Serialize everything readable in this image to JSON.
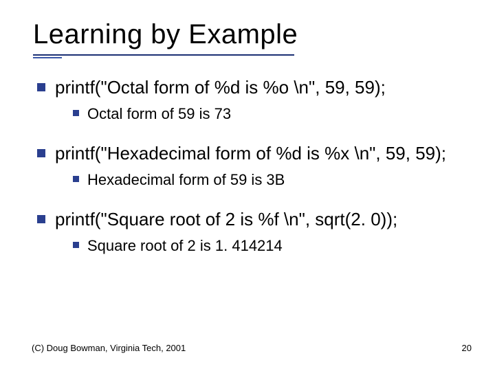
{
  "title": "Learning by Example",
  "items": [
    {
      "code": "printf(\"Octal form of %d is %o \\n\", 59, 59);",
      "output": "Octal form of 59 is 73"
    },
    {
      "code": "printf(\"Hexadecimal form of %d is %x \\n\", 59, 59);",
      "output": "Hexadecimal form of 59 is 3B"
    },
    {
      "code": "printf(\"Square root of 2 is %f \\n\", sqrt(2. 0));",
      "output": "Square root of 2 is 1. 414214"
    }
  ],
  "footer": {
    "copyright": "(C) Doug Bowman, Virginia Tech, 2001",
    "page": "20"
  }
}
